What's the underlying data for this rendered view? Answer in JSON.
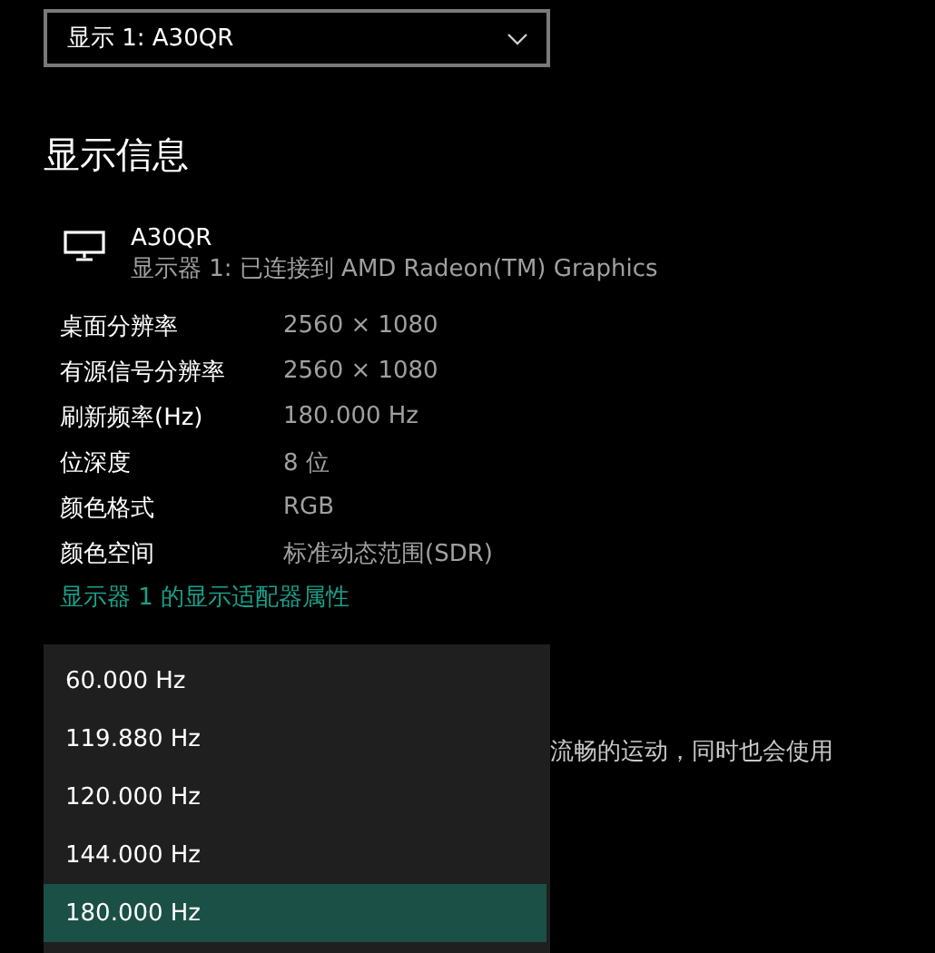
{
  "display_select": {
    "value": "显示 1: A30QR"
  },
  "section_title": "显示信息",
  "monitor": {
    "name": "A30QR",
    "connection": "显示器 1: 已连接到 AMD Radeon(TM) Graphics"
  },
  "properties": [
    {
      "label": "桌面分辨率",
      "value": "2560 × 1080"
    },
    {
      "label": "有源信号分辨率",
      "value": "2560 × 1080"
    },
    {
      "label": "刷新频率(Hz)",
      "value": "180.000 Hz"
    },
    {
      "label": "位深度",
      "value": "8 位"
    },
    {
      "label": "颜色格式",
      "value": "RGB"
    },
    {
      "label": "颜色空间",
      "value": "标准动态范围(SDR)"
    }
  ],
  "adapter_link": "显示器 1 的显示适配器属性",
  "description_fragment": "流畅的运动，同时也会使用",
  "refresh_rate_menu": {
    "options": [
      {
        "label": "60.000 Hz",
        "selected": false
      },
      {
        "label": "119.880 Hz",
        "selected": false
      },
      {
        "label": "120.000 Hz",
        "selected": false
      },
      {
        "label": "144.000 Hz",
        "selected": false
      },
      {
        "label": "180.000 Hz",
        "selected": true
      }
    ]
  }
}
